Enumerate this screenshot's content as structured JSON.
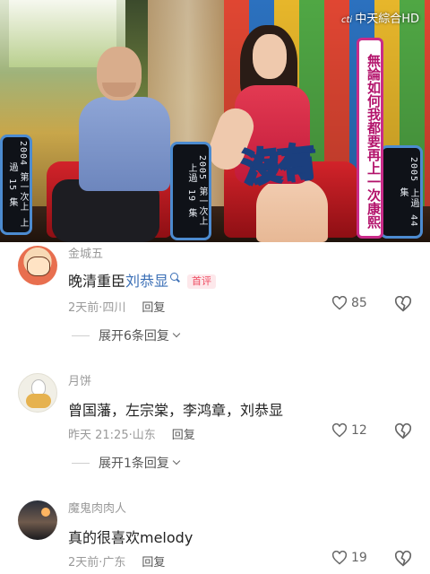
{
  "video": {
    "channel_prefix": "cti",
    "channel_name": "中天綜合HD",
    "overlay_big": "沒有",
    "overlay_vertical": "無論如何我都要再上一次康熙",
    "sign_left": "2004 第一次上 上過 15 集",
    "sign_middle": "2005 第一次上 上過 19 集",
    "sign_right": "2005 上過 44 集"
  },
  "comments": [
    {
      "username": "金城五",
      "text_prefix": "晚清重臣",
      "text_highlight": "刘恭显",
      "badge": "首评",
      "time": "2天前·四川",
      "reply_label": "回复",
      "likes": "85",
      "expand_label": "展开6条回复"
    },
    {
      "username": "月饼",
      "text": "曾国藩，左宗棠，李鸿章，刘恭显",
      "time": "昨天 21:25·山东",
      "reply_label": "回复",
      "likes": "12",
      "expand_label": "展开1条回复"
    },
    {
      "username": "魔鬼肉肉人",
      "text": "真的很喜欢melody",
      "time": "2天前·广东",
      "reply_label": "回复",
      "likes": "19"
    }
  ],
  "colors": {
    "highlight": "#3b6fb6",
    "badge_text": "#ee4d63",
    "badge_bg": "#fde8eb",
    "muted": "#9a9a9a"
  }
}
